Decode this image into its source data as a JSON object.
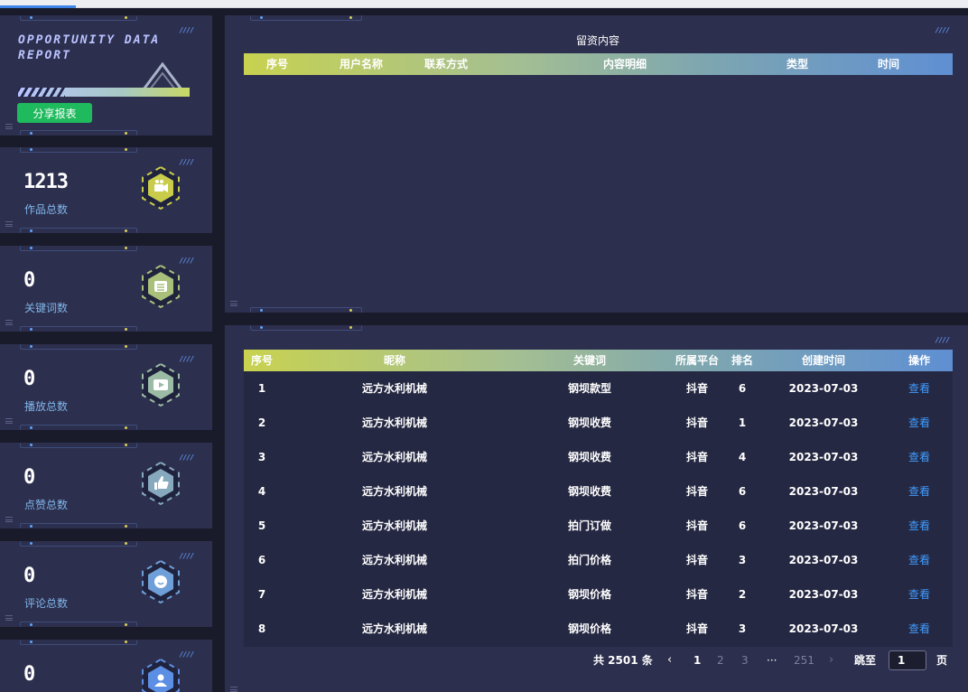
{
  "report": {
    "title_line1": "OPPORTUNITY DATA",
    "title_line2": "REPORT",
    "share_button": "分享报表"
  },
  "stats": [
    {
      "value": "1213",
      "label": "作品总数",
      "icon": "video-camera-icon",
      "icon_color": "#c8cc4a"
    },
    {
      "value": "0",
      "label": "关键词数",
      "icon": "list-icon",
      "icon_color": "#a9c07a"
    },
    {
      "value": "0",
      "label": "播放总数",
      "icon": "play-icon",
      "icon_color": "#9cbba5"
    },
    {
      "value": "0",
      "label": "点赞总数",
      "icon": "thumbs-up-icon",
      "icon_color": "#87a9bd"
    },
    {
      "value": "0",
      "label": "评论总数",
      "icon": "chat-icon",
      "icon_color": "#6f9fd8"
    },
    {
      "value": "0",
      "label": "",
      "icon": "user-icon",
      "icon_color": "#5c8fe3"
    }
  ],
  "leads_table": {
    "caption": "留资内容",
    "headers": [
      "序号",
      "用户名称",
      "联系方式",
      "内容明细",
      "类型",
      "时间"
    ],
    "rows": []
  },
  "keyword_table": {
    "headers": [
      "序号",
      "昵称",
      "关键词",
      "所属平台",
      "排名",
      "创建时间",
      "操作"
    ],
    "rows": [
      {
        "index": "1",
        "nickname": "远方水利机械",
        "keyword": "钢坝款型",
        "platform": "抖音",
        "rank": "6",
        "created": "2023-07-03",
        "action": "查看"
      },
      {
        "index": "2",
        "nickname": "远方水利机械",
        "keyword": "钢坝收费",
        "platform": "抖音",
        "rank": "1",
        "created": "2023-07-03",
        "action": "查看"
      },
      {
        "index": "3",
        "nickname": "远方水利机械",
        "keyword": "钢坝收费",
        "platform": "抖音",
        "rank": "4",
        "created": "2023-07-03",
        "action": "查看"
      },
      {
        "index": "4",
        "nickname": "远方水利机械",
        "keyword": "钢坝收费",
        "platform": "抖音",
        "rank": "6",
        "created": "2023-07-03",
        "action": "查看"
      },
      {
        "index": "5",
        "nickname": "远方水利机械",
        "keyword": "拍门订做",
        "platform": "抖音",
        "rank": "6",
        "created": "2023-07-03",
        "action": "查看"
      },
      {
        "index": "6",
        "nickname": "远方水利机械",
        "keyword": "拍门价格",
        "platform": "抖音",
        "rank": "3",
        "created": "2023-07-03",
        "action": "查看"
      },
      {
        "index": "7",
        "nickname": "远方水利机械",
        "keyword": "钢坝价格",
        "platform": "抖音",
        "rank": "2",
        "created": "2023-07-03",
        "action": "查看"
      },
      {
        "index": "8",
        "nickname": "远方水利机械",
        "keyword": "钢坝价格",
        "platform": "抖音",
        "rank": "3",
        "created": "2023-07-03",
        "action": "查看"
      }
    ]
  },
  "pagination": {
    "total": "共 2501 条",
    "prev": "‹",
    "pages": [
      "1",
      "2",
      "3",
      "···",
      "251"
    ],
    "current": "1",
    "next": "›",
    "jump_label": "跳至",
    "jump_value": "1",
    "page_unit": "页"
  },
  "colors": {
    "background": "#191b2b",
    "panel": "#2d2f4e",
    "header_gradient_start": "#c8d250",
    "header_gradient_end": "#5f8fd3",
    "label_blue": "#7fb6ea",
    "link_blue": "#3f9bff",
    "share_green": "#1fb95e"
  }
}
